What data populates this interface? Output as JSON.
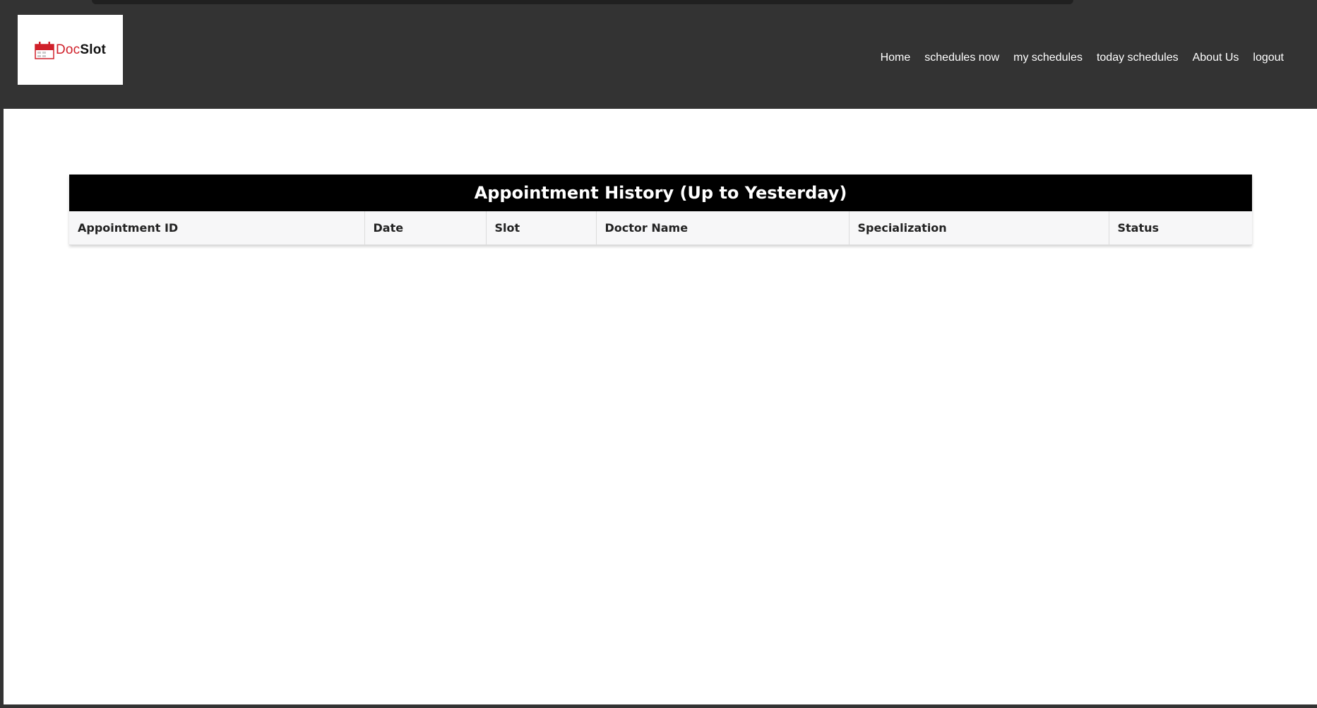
{
  "brand": {
    "logo_doc": "Doc",
    "logo_slot": "Slot",
    "accent_color": "#d0202a"
  },
  "nav": {
    "items": [
      {
        "label": "Home"
      },
      {
        "label": "schedules now"
      },
      {
        "label": "my schedules"
      },
      {
        "label": "today schedules"
      },
      {
        "label": "About Us"
      },
      {
        "label": "logout"
      }
    ]
  },
  "table": {
    "title": "Appointment History (Up to Yesterday)",
    "columns": [
      "Appointment ID",
      "Date",
      "Slot",
      "Doctor Name",
      "Specialization",
      "Status"
    ],
    "rows": []
  }
}
